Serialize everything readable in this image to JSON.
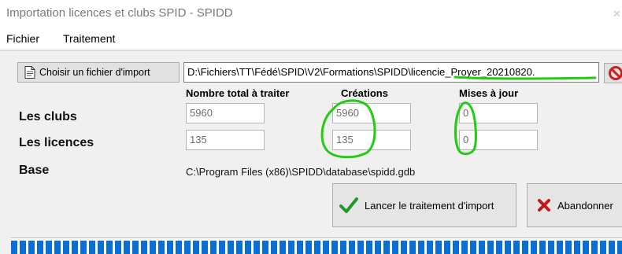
{
  "window": {
    "title": "Importation licences et clubs SPID - SPIDD"
  },
  "menu": {
    "items": [
      "Fichier",
      "Traitement"
    ]
  },
  "import": {
    "choose_button_label": "Choisir un fichier d'import",
    "file_path": "D:\\Fichiers\\TT\\Fédé\\SPID\\V2\\Formations\\SPIDD\\licencie_Proyer_20210820."
  },
  "columns": {
    "total": "Nombre total à traiter",
    "creations": "Créations",
    "updates": "Mises à jour"
  },
  "rows": {
    "clubs": {
      "label": "Les clubs",
      "total": "5960",
      "creations": "5960",
      "updates": "0"
    },
    "licences": {
      "label": "Les licences",
      "total": "135",
      "creations": "135",
      "updates": "0"
    }
  },
  "base": {
    "label": "Base",
    "value": "C:\\Program Files (x86)\\SPIDD\\database\\spidd.gdb"
  },
  "actions": {
    "launch_label": "Lancer le traitement d'import",
    "abandon_label": "Abandonner"
  },
  "progress": {
    "fraction": 1.0
  },
  "icons": {
    "file": "file-icon",
    "cancel": "no-entry-icon",
    "check": "green-check-icon",
    "cross": "red-cross-icon"
  },
  "colors": {
    "annotation": "#22cc11",
    "progress": "#0a6fd4",
    "check": "#1f9a2a",
    "cross": "#c0191b"
  }
}
